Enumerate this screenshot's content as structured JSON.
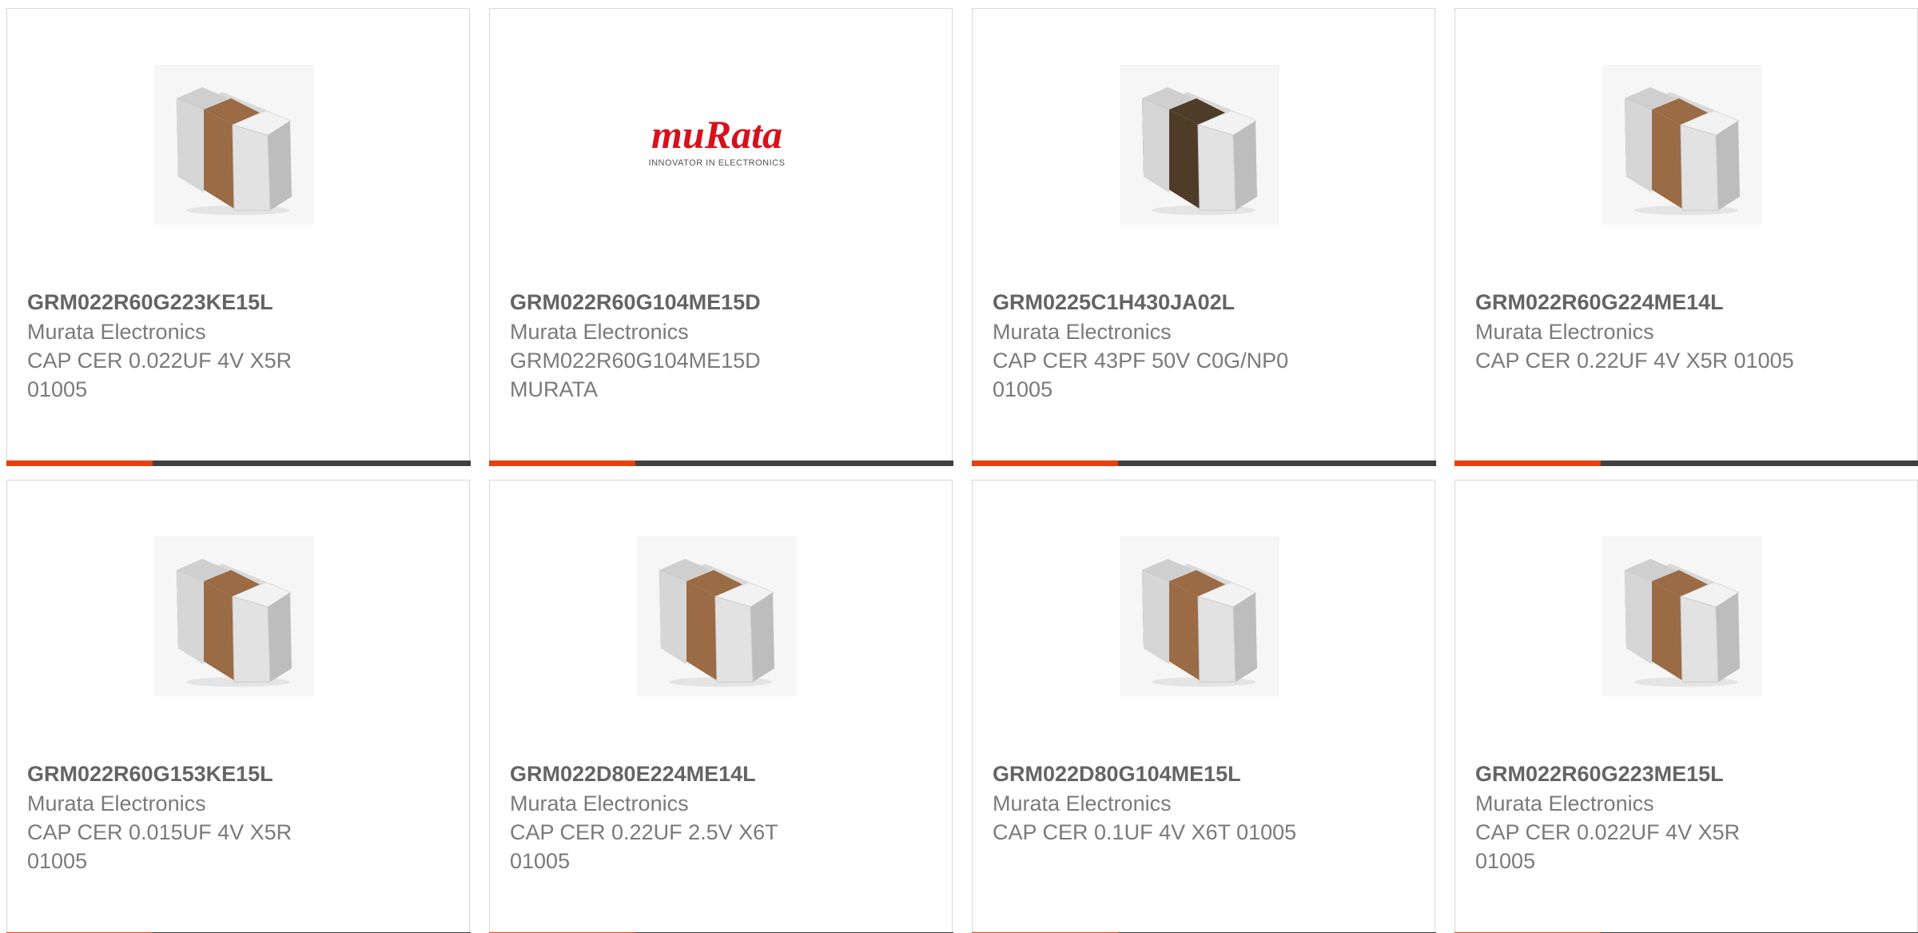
{
  "products": [
    {
      "part_number": "GRM022R60G223KE15L",
      "manufacturer": "Murata Electronics",
      "description": "CAP CER 0.022UF 4V X5R 01005",
      "image_icon": "chip-capacitor-icon"
    },
    {
      "part_number": "GRM022R60G104ME15D",
      "manufacturer": "Murata Electronics",
      "description": "GRM022R60G104ME15D MURATA",
      "image_icon": "murata-logo",
      "logo": {
        "brand": "muRata",
        "tagline": "INNOVATOR IN ELECTRONICS"
      }
    },
    {
      "part_number": "GRM0225C1H430JA02L",
      "manufacturer": "Murata Electronics",
      "description": "CAP CER 43PF 50V C0G/NP0 01005",
      "image_icon": "chip-capacitor-dark-icon"
    },
    {
      "part_number": "GRM022R60G224ME14L",
      "manufacturer": "Murata Electronics",
      "description": "CAP CER 0.22UF 4V X5R 01005",
      "image_icon": "chip-capacitor-icon"
    },
    {
      "part_number": "GRM022R60G153KE15L",
      "manufacturer": "Murata Electronics",
      "description": "CAP CER 0.015UF 4V X5R 01005",
      "image_icon": "chip-capacitor-icon"
    },
    {
      "part_number": "GRM022D80E224ME14L",
      "manufacturer": "Murata Electronics",
      "description": "CAP CER 0.22UF 2.5V X6T 01005",
      "image_icon": "chip-capacitor-icon"
    },
    {
      "part_number": "GRM022D80G104ME15L",
      "manufacturer": "Murata Electronics",
      "description": "CAP CER 0.1UF 4V X6T 01005",
      "image_icon": "chip-capacitor-icon"
    },
    {
      "part_number": "GRM022R60G223ME15L",
      "manufacturer": "Murata Electronics",
      "description": "CAP CER 0.022UF 4V X5R 01005",
      "image_icon": "chip-capacitor-icon"
    }
  ],
  "colors": {
    "accent": "#e8400c",
    "bar": "#404040",
    "card_border": "#d9d9d9",
    "part_text": "#646464",
    "body_text": "#7a7a7a",
    "capacitor_body": "#9a6b45",
    "capacitor_body_dark": "#4e3c28",
    "logo_red": "#d8101c"
  }
}
